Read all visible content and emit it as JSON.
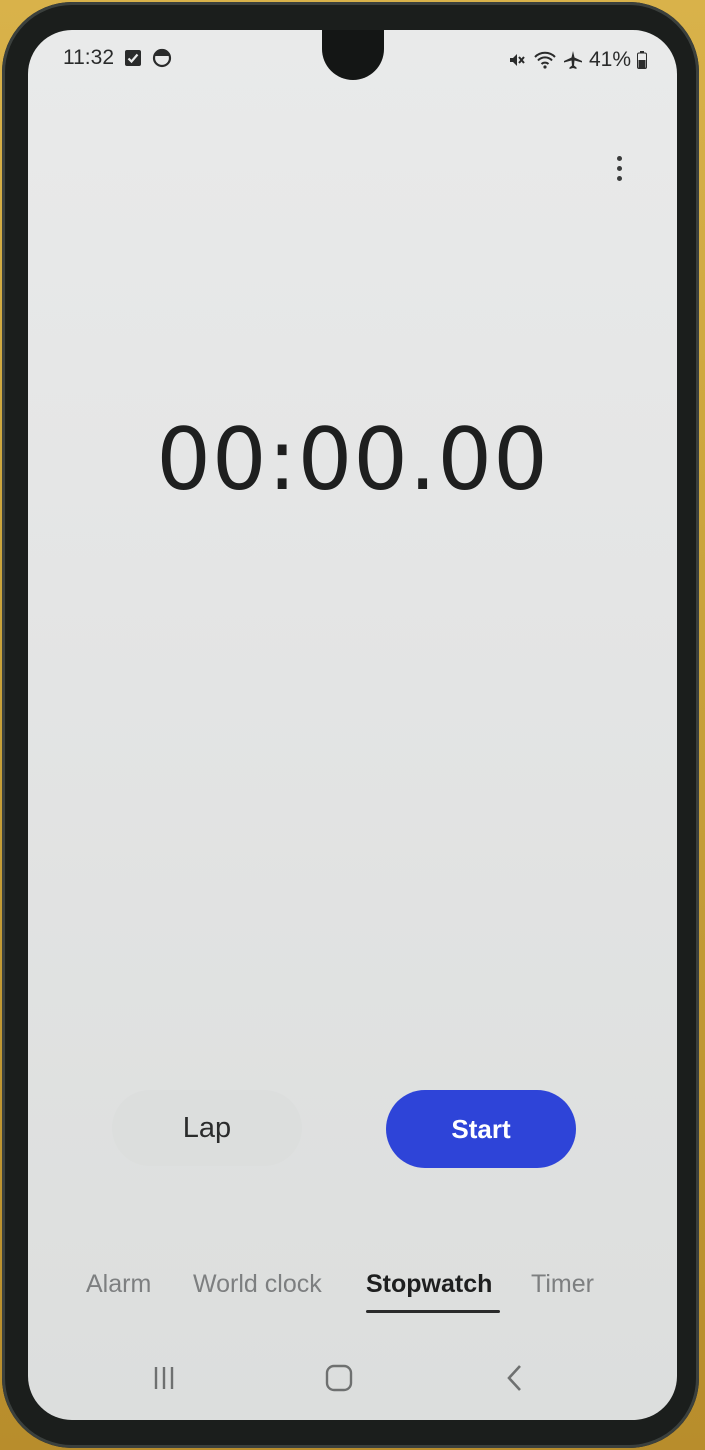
{
  "status_bar": {
    "time": "11:32",
    "battery": "41%",
    "left_icons": [
      "checkbox-notification-icon",
      "clock-app-icon"
    ],
    "right_icons": [
      "mute-icon",
      "wifi-icon",
      "airplane-icon",
      "battery-icon"
    ]
  },
  "stopwatch": {
    "time": "00:00.00"
  },
  "controls": {
    "lap_label": "Lap",
    "start_label": "Start"
  },
  "tabs": [
    {
      "label": "Alarm",
      "active": false
    },
    {
      "label": "World clock",
      "active": false
    },
    {
      "label": "Stopwatch",
      "active": true
    },
    {
      "label": "Timer",
      "active": false
    }
  ],
  "colors": {
    "accent": "#2e44d8",
    "background": "#e6e7e7",
    "text": "#1e1f1f",
    "inactive_tab": "#7d7f80"
  },
  "navigation_bar": {
    "items": [
      "recent-apps-icon",
      "home-icon",
      "back-icon"
    ]
  }
}
